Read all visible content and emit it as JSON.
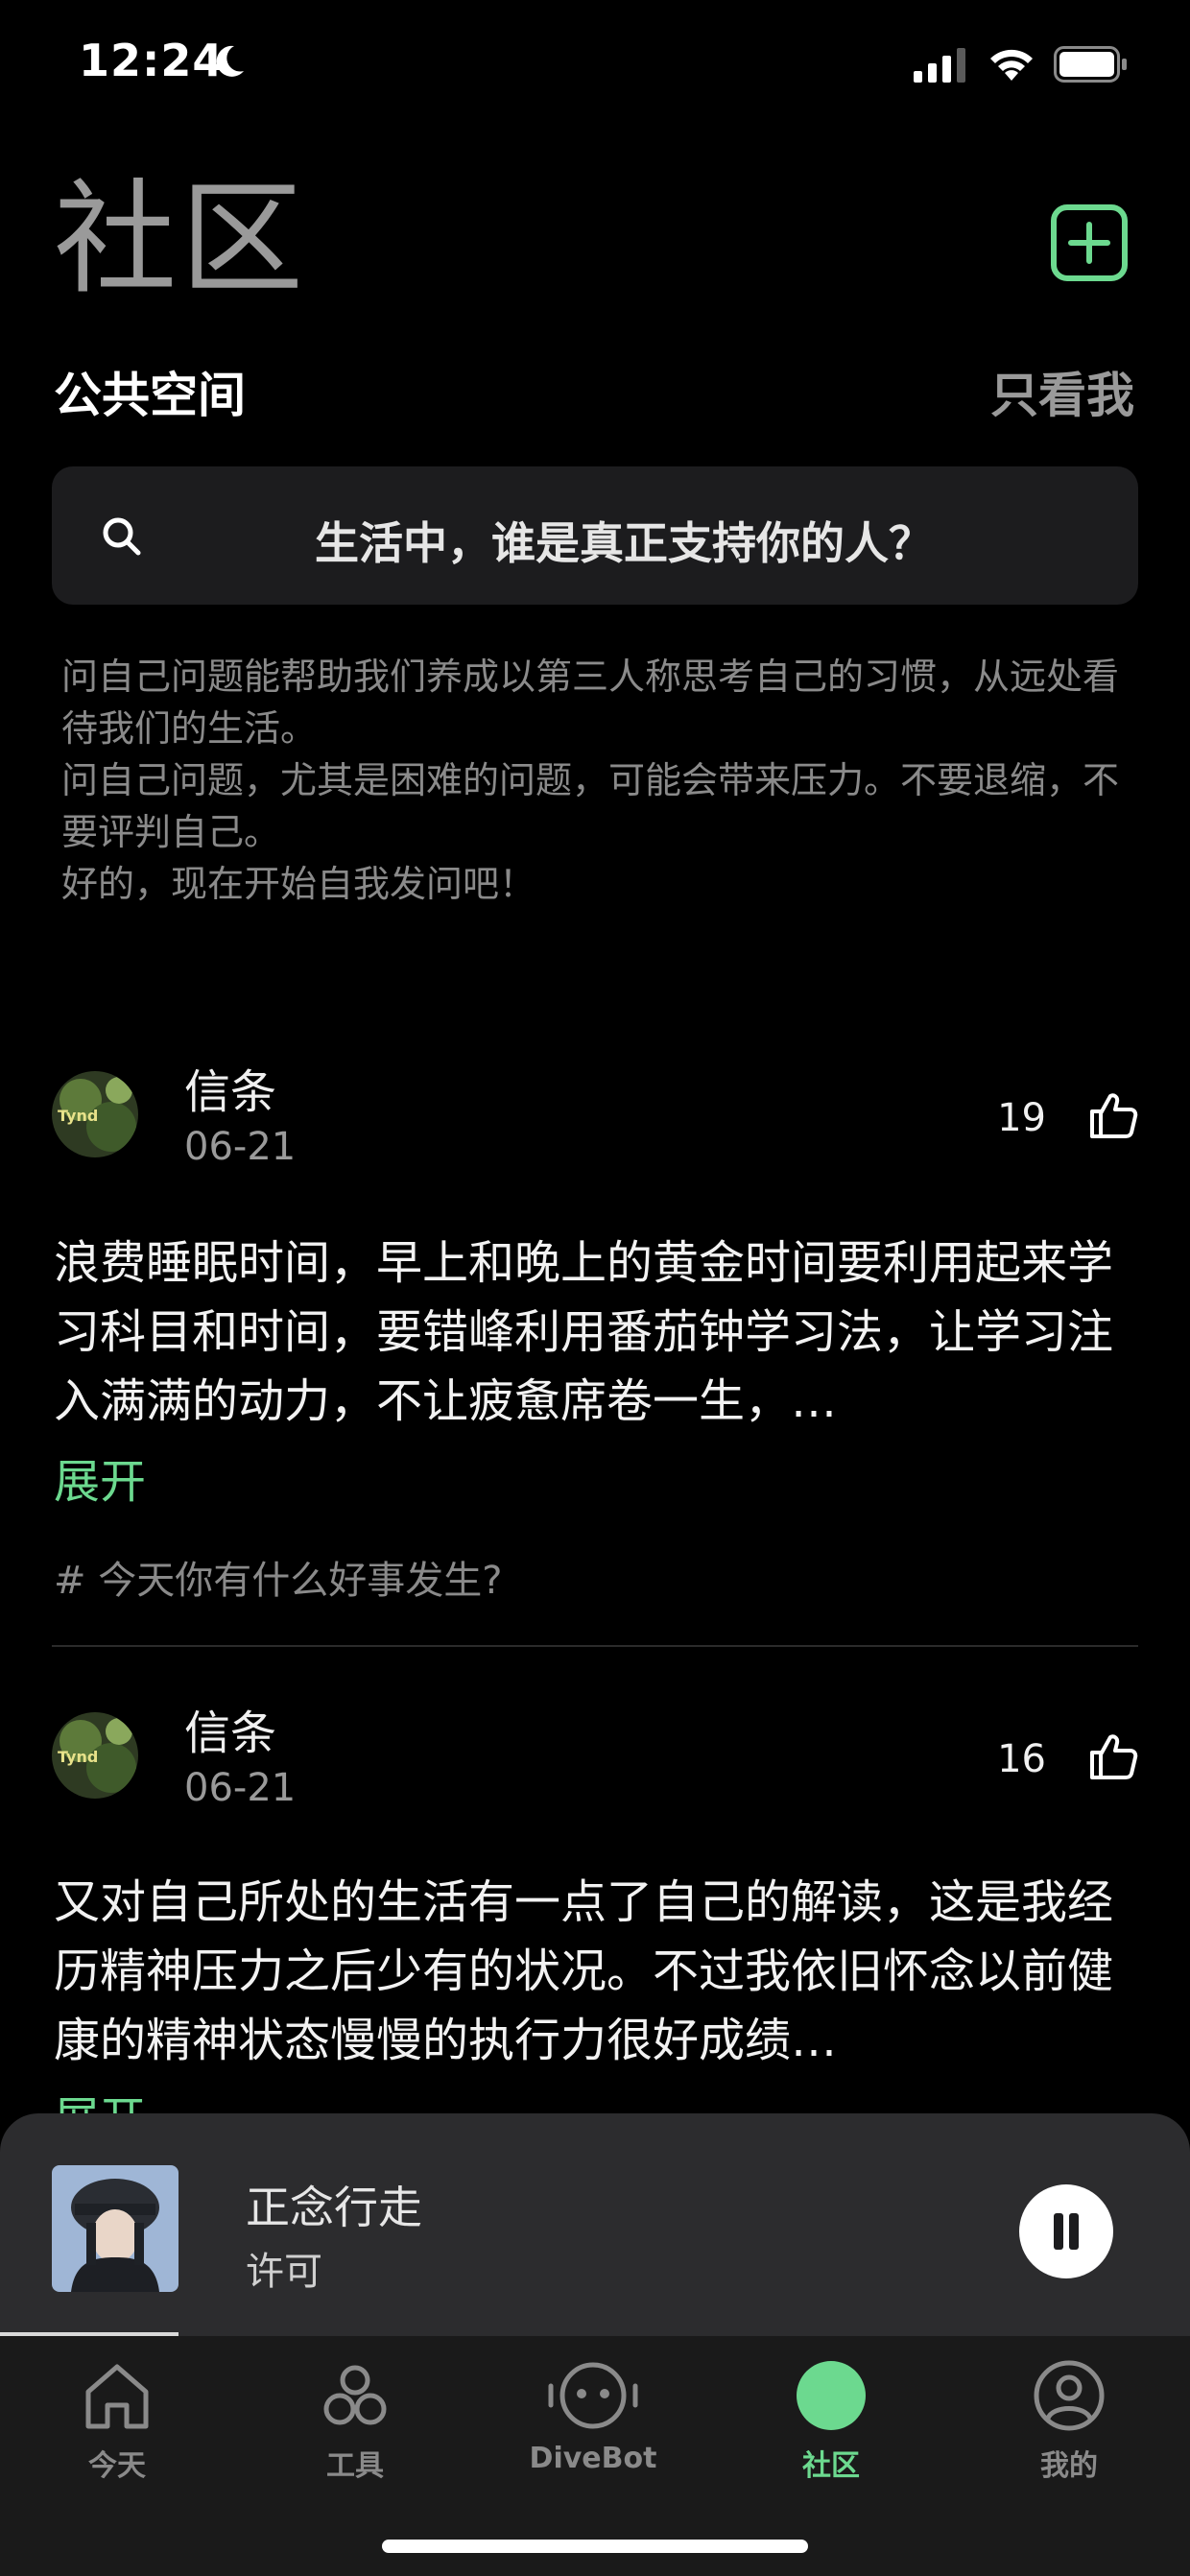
{
  "status": {
    "time": "12:24"
  },
  "header": {
    "title": "社区",
    "space_label": "公共空间",
    "only_me": "只看我"
  },
  "search": {
    "question": "生活中，谁是真正支持你的人？"
  },
  "description": [
    "问自己问题能帮助我们养成以第三人称思考自己的习惯，从远处看待我们的生活。",
    "问自己问题，尤其是困难的问题，可能会带来压力。不要退缩，不要评判自己。",
    "好的，现在开始自我发问吧！"
  ],
  "posts": [
    {
      "author": "信条",
      "date": "06-21",
      "likes": "19",
      "text": "浪费睡眠时间，早上和晚上的黄金时间要利用起来学习科目和时间，要错峰利用番茄钟学习法，让学习注入满满的动力，不让疲惫席卷一生，…",
      "expand": "展开",
      "tag": "# 今天你有什么好事发生?"
    },
    {
      "author": "信条",
      "date": "06-21",
      "likes": "16",
      "text": "又对自己所处的生活有一点了自己的解读，这是我经历精神压力之后少有的状况。不过我依旧怀念以前健康的精神状态慢慢的执行力很好成绩…",
      "expand": "展开"
    }
  ],
  "player": {
    "track": "正念行走",
    "artist": "许可",
    "progress": 0.15
  },
  "tabs": [
    {
      "label": "今天",
      "icon": "home-icon"
    },
    {
      "label": "工具",
      "icon": "tools-icon"
    },
    {
      "label": "DiveBot",
      "icon": "bot-icon"
    },
    {
      "label": "社区",
      "icon": "community-icon",
      "active": true
    },
    {
      "label": "我的",
      "icon": "profile-icon"
    }
  ],
  "colors": {
    "accent": "#6cd98f",
    "background": "#000000",
    "card": "#1c1c1e"
  }
}
